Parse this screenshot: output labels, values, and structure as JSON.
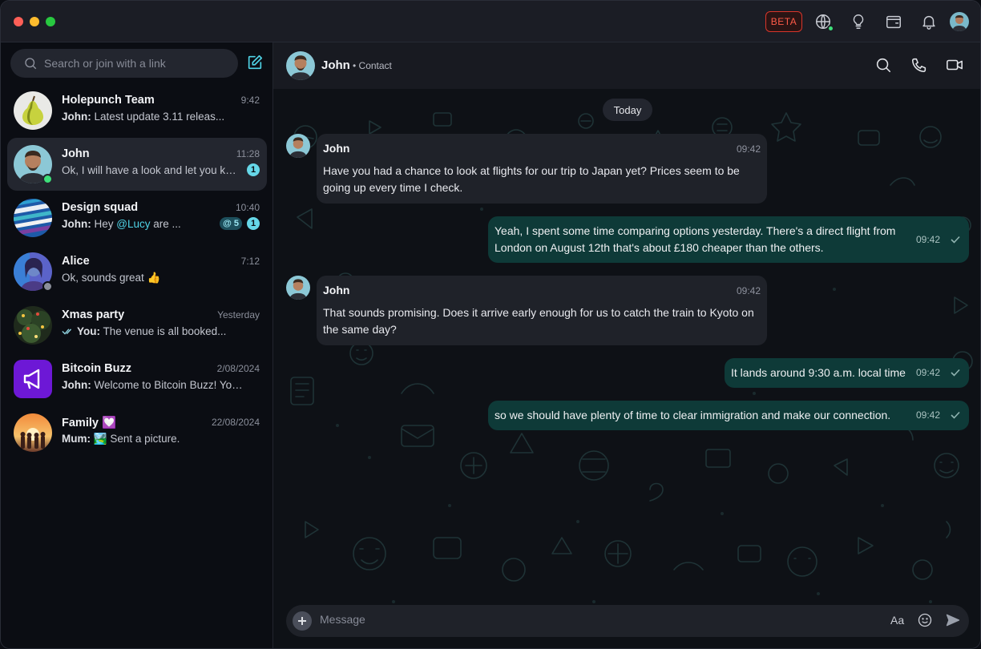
{
  "titlebar": {
    "beta_label": "BETA",
    "icons": [
      "globe-icon",
      "lightbulb-icon",
      "wallet-icon",
      "bell-icon"
    ]
  },
  "sidebar": {
    "search": {
      "placeholder": "Search or join with a link",
      "value": ""
    },
    "chats": [
      {
        "name": "Holepunch Team",
        "time": "9:42",
        "sender": "John:",
        "preview": "Latest update 3.11 releas...",
        "unread": "",
        "status": ""
      },
      {
        "name": "John",
        "time": "11:28",
        "sender": "",
        "preview": "Ok, I will have a look and let you kn...",
        "unread": "1",
        "status": "online"
      },
      {
        "name": "Design squad",
        "time": "10:40",
        "sender": "John:",
        "preview_pre": "Hey ",
        "mention": "@Lucy",
        "preview_post": " are ...",
        "mentions_badge": "@ 5",
        "unread": "1",
        "status": ""
      },
      {
        "name": "Alice",
        "time": "7:12",
        "sender": "",
        "preview": "Ok, sounds great 👍",
        "unread": "",
        "status": "away"
      },
      {
        "name": "Xmas party",
        "time": "Yesterday",
        "sender": "You:",
        "preview": "The venue is all booked...",
        "unread": "",
        "status": ""
      },
      {
        "name": "Bitcoin Buzz",
        "time": "2/08/2024",
        "sender": "John:",
        "preview": "Welcome to Bitcoin Buzz! Your...",
        "unread": "",
        "status": ""
      },
      {
        "name": "Family 💟",
        "time": "22/08/2024",
        "sender": "Mum:",
        "preview": "🏞️ Sent a picture.",
        "unread": "",
        "status": ""
      }
    ]
  },
  "conversation": {
    "header": {
      "name": "John",
      "subtitle": "• Contact"
    },
    "date_divider": "Today",
    "messages": [
      {
        "direction": "in",
        "sender": "John",
        "time": "09:42",
        "text": "Have you had a chance to look at flights for our trip to Japan yet? Prices seem to be going up every time I check."
      },
      {
        "direction": "out",
        "time": "09:42",
        "text_line1": "Yeah, I spent some time comparing options yesterday. There's a direct flight from",
        "text_line2": "London on August 12th that's about £180 cheaper than the others."
      },
      {
        "direction": "in",
        "sender": "John",
        "time": "09:42",
        "text": "That sounds promising. Does it arrive early enough for us to catch the train to Kyoto on the same day?"
      },
      {
        "direction": "out",
        "time": "09:42",
        "text": "It lands around 9:30 a.m. local time"
      },
      {
        "direction": "out",
        "time": "09:42",
        "text": "so we should have plenty of time to clear immigration and make our connection."
      }
    ],
    "composer": {
      "placeholder": "Message",
      "value": "",
      "format_label": "Aa"
    }
  },
  "colors": {
    "accent": "#4fd3e6",
    "outgoing_bubble": "#0e3a38",
    "incoming_bubble": "#1f2229",
    "online": "#3ee07a",
    "beta": "#ff5b48"
  }
}
